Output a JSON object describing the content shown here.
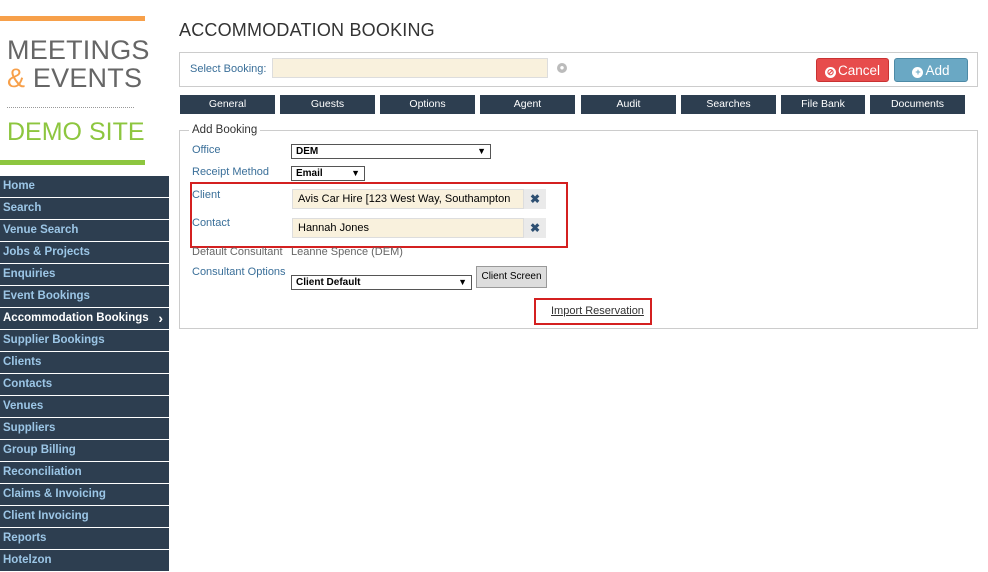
{
  "logo": {
    "line1": "MEETINGS",
    "amp": "&",
    "line2": "EVENTS",
    "line3": "DEMO SITE"
  },
  "nav": {
    "items": [
      "Home",
      "Search",
      "Venue Search",
      "Jobs & Projects",
      "Enquiries",
      "Event Bookings",
      "Accommodation Bookings",
      "Supplier Bookings",
      "Clients",
      "Contacts",
      "Venues",
      "Suppliers",
      "Group Billing",
      "Reconciliation",
      "Claims & Invoicing",
      "Client Invoicing",
      "Reports",
      "Hotelzon"
    ],
    "active": "Accommodation Bookings",
    "active_icon": "chevron-right-icon"
  },
  "page": {
    "title": "ACCOMMODATION BOOKING"
  },
  "select_booking": {
    "label": "Select Booking:",
    "value": "",
    "icon": "globe-icon"
  },
  "buttons": {
    "cancel": "Cancel",
    "add": "Add",
    "cancel_icon": "ban-icon",
    "add_icon": "plus-circle-icon"
  },
  "tabs": [
    "General",
    "Guests",
    "Options",
    "Agent",
    "Audit",
    "Searches",
    "File Bank",
    "Documents"
  ],
  "form": {
    "legend": "Add Booking",
    "office": {
      "label": "Office",
      "value": "DEM"
    },
    "receipt_method": {
      "label": "Receipt Method",
      "value": "Email"
    },
    "client": {
      "label": "Client",
      "value": "Avis Car Hire [123 West Way, Southampton"
    },
    "contact": {
      "label": "Contact",
      "value": "Hannah Jones"
    },
    "clear_glyph": "✖",
    "default_consultant": {
      "label": "Default Consultant",
      "value": "Leanne Spence (DEM)"
    },
    "consultant_options": {
      "label": "Consultant Options",
      "value": "Client Default",
      "button": "Client Screen"
    },
    "import_link": "Import Reservation"
  },
  "colors": {
    "nav_bg": "#2d3e50",
    "accent_orange": "#f7a04a",
    "accent_green": "#8dc63f",
    "cancel": "#e74c4c",
    "add": "#6aa8c4",
    "highlight": "#d42020"
  }
}
